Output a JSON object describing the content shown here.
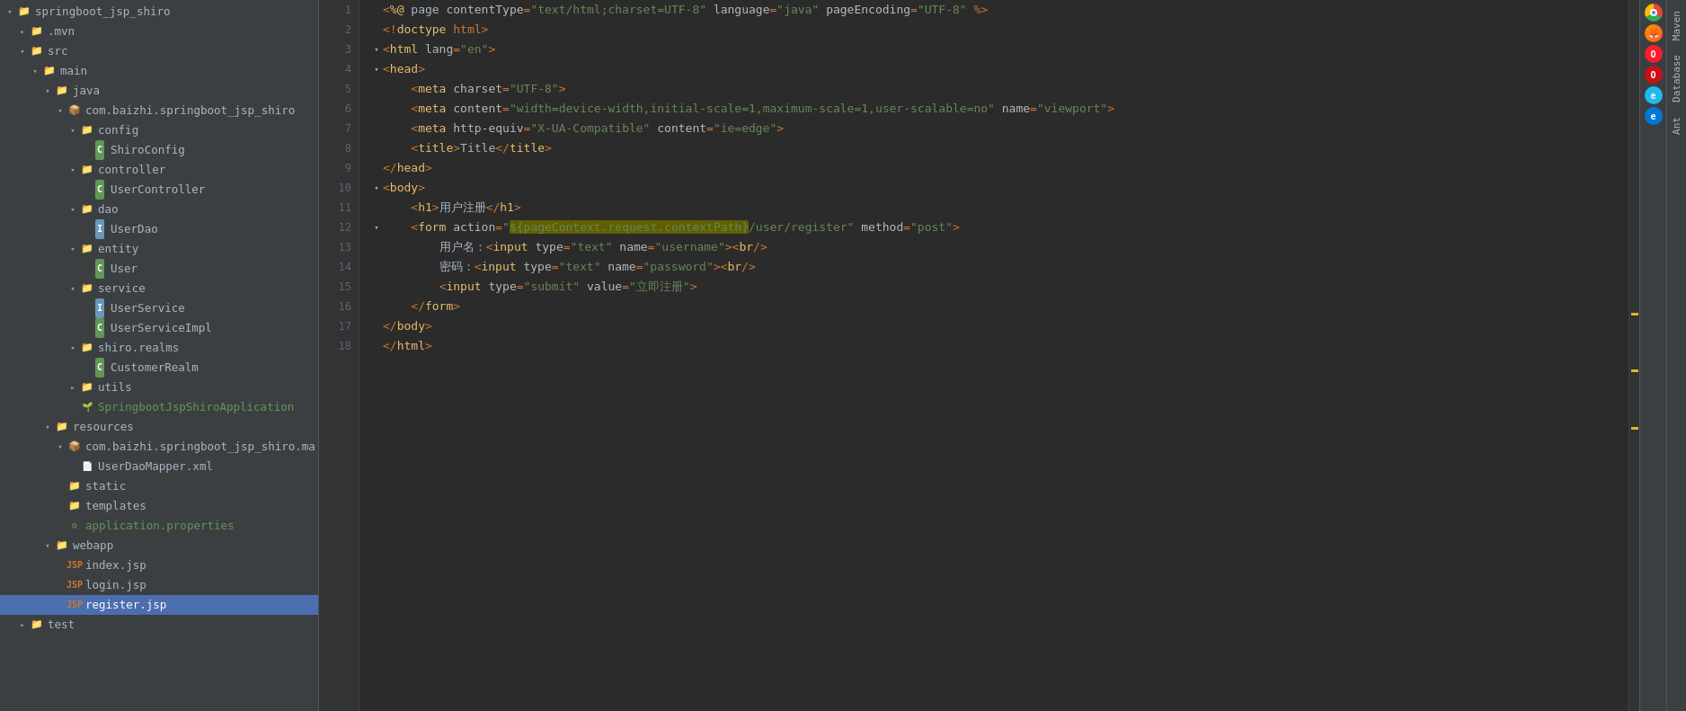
{
  "project": {
    "root": "springboot_jsp_shiro",
    "tree": [
      {
        "id": "root",
        "label": "springboot_jsp_shiro",
        "indent": "indent1",
        "type": "project",
        "expanded": true,
        "arrow": "▾"
      },
      {
        "id": "mvn",
        "label": ".mvn",
        "indent": "indent2",
        "type": "folder",
        "expanded": false,
        "arrow": "▸"
      },
      {
        "id": "src",
        "label": "src",
        "indent": "indent2",
        "type": "folder",
        "expanded": true,
        "arrow": "▾"
      },
      {
        "id": "main",
        "label": "main",
        "indent": "indent3",
        "type": "folder",
        "expanded": true,
        "arrow": "▾"
      },
      {
        "id": "java",
        "label": "java",
        "indent": "indent4",
        "type": "folder",
        "expanded": true,
        "arrow": "▾"
      },
      {
        "id": "com",
        "label": "com.baizhi.springboot_jsp_shiro",
        "indent": "indent5",
        "type": "package",
        "expanded": true,
        "arrow": "▾"
      },
      {
        "id": "config",
        "label": "config",
        "indent": "indent6",
        "type": "folder",
        "expanded": true,
        "arrow": "▾"
      },
      {
        "id": "ShiroConfig",
        "label": "ShiroConfig",
        "indent": "indent7",
        "type": "class",
        "expanded": false,
        "arrow": ""
      },
      {
        "id": "controller",
        "label": "controller",
        "indent": "indent6",
        "type": "folder",
        "expanded": true,
        "arrow": "▾"
      },
      {
        "id": "UserController",
        "label": "UserController",
        "indent": "indent7",
        "type": "class",
        "expanded": false,
        "arrow": ""
      },
      {
        "id": "dao",
        "label": "dao",
        "indent": "indent6",
        "type": "folder",
        "expanded": true,
        "arrow": "▾"
      },
      {
        "id": "UserDao",
        "label": "UserDao",
        "indent": "indent7",
        "type": "interface",
        "expanded": false,
        "arrow": ""
      },
      {
        "id": "entity",
        "label": "entity",
        "indent": "indent6",
        "type": "folder",
        "expanded": true,
        "arrow": "▾"
      },
      {
        "id": "User",
        "label": "User",
        "indent": "indent7",
        "type": "class",
        "expanded": false,
        "arrow": ""
      },
      {
        "id": "service",
        "label": "service",
        "indent": "indent6",
        "type": "folder",
        "expanded": true,
        "arrow": "▾"
      },
      {
        "id": "UserService",
        "label": "UserService",
        "indent": "indent7",
        "type": "interface",
        "expanded": false,
        "arrow": ""
      },
      {
        "id": "UserServiceImpl",
        "label": "UserServiceImpl",
        "indent": "indent7",
        "type": "class",
        "expanded": false,
        "arrow": ""
      },
      {
        "id": "shiro_realms",
        "label": "shiro.realms",
        "indent": "indent6",
        "type": "folder",
        "expanded": true,
        "arrow": "▾"
      },
      {
        "id": "CustomerRealm",
        "label": "CustomerRealm",
        "indent": "indent7",
        "type": "class",
        "expanded": false,
        "arrow": ""
      },
      {
        "id": "utils",
        "label": "utils",
        "indent": "indent6",
        "type": "folder",
        "expanded": false,
        "arrow": "▸"
      },
      {
        "id": "SpringbootJspShiroApplication",
        "label": "SpringbootJspShiroApplication",
        "indent": "indent6",
        "type": "spring",
        "expanded": false,
        "arrow": ""
      },
      {
        "id": "resources",
        "label": "resources",
        "indent": "indent4",
        "type": "folder",
        "expanded": true,
        "arrow": "▾"
      },
      {
        "id": "com_res",
        "label": "com.baizhi.springboot_jsp_shiro.ma",
        "indent": "indent5",
        "type": "package",
        "expanded": true,
        "arrow": "▾"
      },
      {
        "id": "UserDaoMapper",
        "label": "UserDaoMapper.xml",
        "indent": "indent6",
        "type": "xml",
        "expanded": false,
        "arrow": ""
      },
      {
        "id": "static",
        "label": "static",
        "indent": "indent5",
        "type": "folder",
        "expanded": false,
        "arrow": ""
      },
      {
        "id": "templates",
        "label": "templates",
        "indent": "indent5",
        "type": "folder",
        "expanded": false,
        "arrow": ""
      },
      {
        "id": "application",
        "label": "application.properties",
        "indent": "indent5",
        "type": "properties",
        "expanded": false,
        "arrow": ""
      },
      {
        "id": "webapp",
        "label": "webapp",
        "indent": "indent4",
        "type": "folder",
        "expanded": true,
        "arrow": "▾"
      },
      {
        "id": "index_jsp",
        "label": "index.jsp",
        "indent": "indent5",
        "type": "jsp",
        "expanded": false,
        "arrow": ""
      },
      {
        "id": "login_jsp",
        "label": "login.jsp",
        "indent": "indent5",
        "type": "jsp",
        "expanded": false,
        "arrow": ""
      },
      {
        "id": "register_jsp",
        "label": "register.jsp",
        "indent": "indent5",
        "type": "jsp",
        "expanded": false,
        "arrow": "",
        "selected": true
      },
      {
        "id": "test",
        "label": "test",
        "indent": "indent2",
        "type": "folder",
        "expanded": false,
        "arrow": "▸"
      }
    ]
  },
  "editor": {
    "lines": [
      {
        "num": 1,
        "content_html": "<span class='punct'>&lt;</span><span class='kw-tag'>%@</span><span class='text-content'> page </span><span class='attr-name'>contentType</span><span class='punct'>=</span><span class='attr-value'>\"text/html;charset=UTF-8\"</span><span class='text-content'> </span><span class='attr-name'>language</span><span class='punct'>=</span><span class='attr-value'>\"java\"</span><span class='text-content'> </span><span class='attr-name'>pageEncoding</span><span class='punct'>=</span><span class='attr-value'>\"UTF-8\"</span><span class='text-content'> </span><span class='punct'>%&gt;</span>",
        "fold": false
      },
      {
        "num": 2,
        "content_html": "<span class='punct'>&lt;!</span><span class='kw-tag'>doctype</span><span class='text-content'> </span><span class='kw-java'>html</span><span class='punct'>&gt;</span>",
        "fold": false
      },
      {
        "num": 3,
        "content_html": "<span class='punct'>&lt;</span><span class='kw-tag'>html</span><span class='text-content'> </span><span class='attr-name'>lang</span><span class='punct'>=</span><span class='attr-value'>\"en\"</span><span class='punct'>&gt;</span>",
        "fold": true
      },
      {
        "num": 4,
        "content_html": "<span class='punct'>&lt;</span><span class='kw-tag'>head</span><span class='punct'>&gt;</span>",
        "fold": true
      },
      {
        "num": 5,
        "content_html": "&nbsp;&nbsp;&nbsp;&nbsp;<span class='punct'>&lt;</span><span class='kw-tag'>meta</span><span class='text-content'> </span><span class='attr-name'>charset</span><span class='punct'>=</span><span class='attr-value'>\"UTF-8\"</span><span class='punct'>&gt;</span>",
        "fold": false
      },
      {
        "num": 6,
        "content_html": "&nbsp;&nbsp;&nbsp;&nbsp;<span class='punct'>&lt;</span><span class='kw-tag'>meta</span><span class='text-content'> </span><span class='attr-name'>content</span><span class='punct'>=</span><span class='attr-value'>\"width=device-width,initial-scale=1,maximum-scale=1,user-scalable=no\"</span><span class='text-content'> </span><span class='attr-name'>name</span><span class='punct'>=</span><span class='attr-value'>\"viewport\"</span><span class='punct'>&gt;</span>",
        "fold": false
      },
      {
        "num": 7,
        "content_html": "&nbsp;&nbsp;&nbsp;&nbsp;<span class='punct'>&lt;</span><span class='kw-tag'>meta</span><span class='text-content'> </span><span class='attr-name'>http-equiv</span><span class='punct'>=</span><span class='attr-value'>\"X-UA-Compatible\"</span><span class='text-content'> </span><span class='attr-name'>content</span><span class='punct'>=</span><span class='attr-value'>\"ie=edge\"</span><span class='punct'>&gt;</span>",
        "fold": false
      },
      {
        "num": 8,
        "content_html": "&nbsp;&nbsp;&nbsp;&nbsp;<span class='punct'>&lt;</span><span class='kw-tag'>title</span><span class='punct'>&gt;</span><span class='text-content'>Title</span><span class='punct'>&lt;/</span><span class='kw-tag'>title</span><span class='punct'>&gt;</span>",
        "fold": false
      },
      {
        "num": 9,
        "content_html": "<span class='punct'>&lt;/</span><span class='kw-tag'>head</span><span class='punct'>&gt;</span>",
        "fold": false
      },
      {
        "num": 10,
        "content_html": "<span class='punct'>&lt;</span><span class='kw-tag'>body</span><span class='punct'>&gt;</span>",
        "fold": true
      },
      {
        "num": 11,
        "content_html": "&nbsp;&nbsp;&nbsp;&nbsp;<span class='punct'>&lt;</span><span class='kw-tag'>h1</span><span class='punct'>&gt;</span><span class='text-content'>用户注册</span><span class='punct'>&lt;/</span><span class='kw-tag'>h1</span><span class='punct'>&gt;</span>",
        "fold": false
      },
      {
        "num": 12,
        "content_html": "&nbsp;&nbsp;&nbsp;&nbsp;<span class='punct'>&lt;</span><span class='kw-tag'>form</span><span class='text-content'> </span><span class='attr-name'>action</span><span class='punct'>=</span><span class='attr-value'>\"<span class='highlight-text'>${pageContext.request.contextPath}</span>/user/register\"</span><span class='text-content'> </span><span class='attr-name'>method</span><span class='punct'>=</span><span class='attr-value'>\"post\"</span><span class='punct'>&gt;</span>",
        "fold": true
      },
      {
        "num": 13,
        "content_html": "&nbsp;&nbsp;&nbsp;&nbsp;&nbsp;&nbsp;&nbsp;&nbsp;<span class='text-content'>用户名：</span><span class='punct'>&lt;</span><span class='kw-tag'>input</span><span class='text-content'> </span><span class='attr-name'>type</span><span class='punct'>=</span><span class='attr-value'>\"text\"</span><span class='text-content'> </span><span class='attr-name'>name</span><span class='punct'>=</span><span class='attr-value'>\"username\"</span><span class='punct'>&gt;&lt;</span><span class='kw-tag'>br</span><span class='punct'>/&gt;</span>",
        "fold": false
      },
      {
        "num": 14,
        "content_html": "&nbsp;&nbsp;&nbsp;&nbsp;&nbsp;&nbsp;&nbsp;&nbsp;<span class='text-content'>密码：</span><span class='punct'>&lt;</span><span class='kw-tag'>input</span><span class='text-content'> </span><span class='attr-name'>type</span><span class='punct'>=</span><span class='attr-value'>\"text\"</span><span class='text-content'> </span><span class='attr-name'>name</span><span class='punct'>=</span><span class='attr-value'>\"password\"</span><span class='punct'>&gt;&lt;</span><span class='kw-tag'>br</span><span class='punct'>/&gt;</span>",
        "fold": false
      },
      {
        "num": 15,
        "content_html": "&nbsp;&nbsp;&nbsp;&nbsp;&nbsp;&nbsp;&nbsp;&nbsp;<span class='punct'>&lt;</span><span class='kw-tag'>input</span><span class='text-content'> </span><span class='attr-name'>type</span><span class='punct'>=</span><span class='attr-value'>\"submit\"</span><span class='text-content'> </span><span class='attr-name'>value</span><span class='punct'>=</span><span class='attr-value'>\"立即注册\"</span><span class='punct'>&gt;</span>",
        "fold": false
      },
      {
        "num": 16,
        "content_html": "&nbsp;&nbsp;&nbsp;&nbsp;<span class='punct'>&lt;/</span><span class='kw-tag'>form</span><span class='punct'>&gt;</span>",
        "fold": false
      },
      {
        "num": 17,
        "content_html": "<span class='punct'>&lt;/</span><span class='kw-tag'>body</span><span class='punct'>&gt;</span>",
        "fold": false
      },
      {
        "num": 18,
        "content_html": "<span class='punct'>&lt;/</span><span class='kw-tag'>html</span><span class='punct'>&gt;</span>",
        "fold": false
      }
    ]
  },
  "sidebar_tabs": [
    "Maven",
    "Database",
    "Ant"
  ],
  "browser_icons": [
    "chrome",
    "firefox",
    "opera-mini",
    "opera",
    "ie",
    "edge"
  ],
  "scrollbar_marks": [
    {
      "top_pct": 44
    },
    {
      "top_pct": 52
    },
    {
      "top_pct": 60
    }
  ]
}
